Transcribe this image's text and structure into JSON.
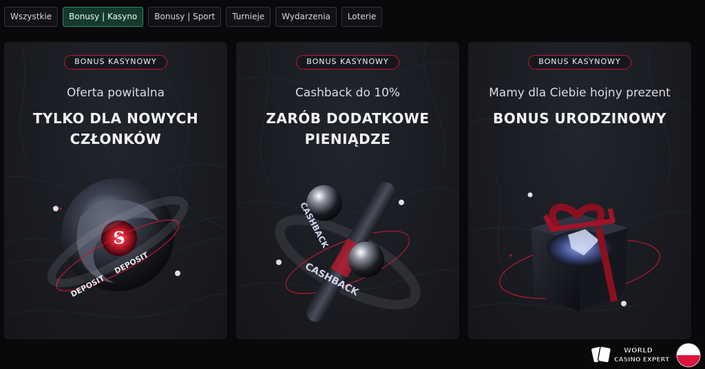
{
  "tabs": [
    {
      "label": "Wszystkie",
      "active": false
    },
    {
      "label": "Bonusy | Kasyno",
      "active": true
    },
    {
      "label": "Bonusy | Sport",
      "active": false
    },
    {
      "label": "Turnieje",
      "active": false
    },
    {
      "label": "Wydarzenia",
      "active": false
    },
    {
      "label": "Loterie",
      "active": false
    }
  ],
  "cards": [
    {
      "badge": "BONUS KASYNOWY",
      "subtitle": "Oferta powitalna",
      "headline": "TYLKO DLA NOWYCH CZŁONKÓW",
      "art_icon": "deposit-sphere-icon",
      "art_text": "DEPOSIT",
      "art_letter": "S"
    },
    {
      "badge": "BONUS KASYNOWY",
      "subtitle": "Cashback do 10%",
      "headline": "ZARÓB DODATKOWE PIENIĄDZE",
      "art_icon": "cashback-percent-icon",
      "art_text": "CASHBACK"
    },
    {
      "badge": "BONUS KASYNOWY",
      "subtitle": "Mamy dla Ciebie hojny prezent",
      "headline": "BONUS URODZINOWY",
      "art_icon": "gift-box-icon"
    }
  ],
  "watermark": {
    "line1": "WORLD",
    "line2": "CASINO EXPERT",
    "icon": "cards-logo-icon",
    "flag_icon": "poland-flag-icon"
  },
  "colors": {
    "accent_red": "#c0182c",
    "active_tab_bg": "#143a2c",
    "active_tab_border": "#2f8a61",
    "card_bg": "#1a1c22",
    "page_bg": "#09090c"
  }
}
